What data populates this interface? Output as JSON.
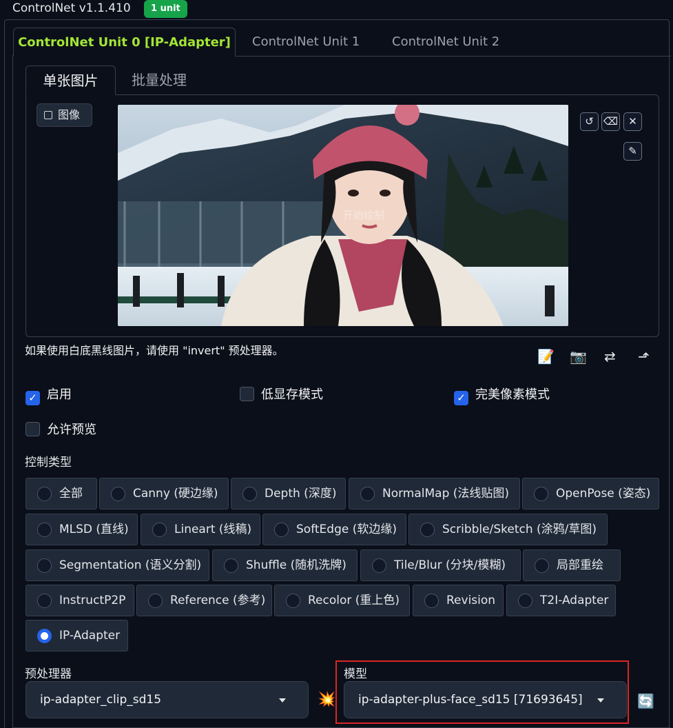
{
  "header": {
    "title": "ControlNet v1.1.410",
    "badge": "1 unit"
  },
  "unit_tabs": [
    {
      "label": "ControlNet Unit 0 [IP-Adapter]",
      "active": true
    },
    {
      "label": "ControlNet Unit 1",
      "active": false
    },
    {
      "label": "ControlNet Unit 2",
      "active": false
    }
  ],
  "input_tabs": [
    {
      "label": "单张图片",
      "active": true
    },
    {
      "label": "批量处理",
      "active": false
    }
  ],
  "image_panel": {
    "label": "图像",
    "watermark": "开始绘制",
    "tools": {
      "undo": "↺",
      "erase": "⌫",
      "close": "✕",
      "brush": "✎"
    }
  },
  "hint": "如果使用白底黑线图片，请使用 \"invert\" 预处理器。",
  "action_icons": {
    "edit": "📝",
    "camera": "📷",
    "swap": "⇄",
    "send": "⬏"
  },
  "checkboxes": [
    {
      "label": "启用",
      "checked": true
    },
    {
      "label": "低显存模式",
      "checked": false
    },
    {
      "label": "完美像素模式",
      "checked": true
    },
    {
      "label": "允许预览",
      "checked": false
    }
  ],
  "control_type": {
    "label": "控制类型",
    "options": [
      {
        "label": "全部",
        "selected": false
      },
      {
        "label": "Canny (硬边缘)",
        "selected": false
      },
      {
        "label": "Depth (深度)",
        "selected": false
      },
      {
        "label": "NormalMap (法线贴图)",
        "selected": false
      },
      {
        "label": "OpenPose (姿态)",
        "selected": false
      },
      {
        "label": "MLSD (直线)",
        "selected": false
      },
      {
        "label": "Lineart (线稿)",
        "selected": false
      },
      {
        "label": "SoftEdge (软边缘)",
        "selected": false
      },
      {
        "label": "Scribble/Sketch (涂鸦/草图)",
        "selected": false
      },
      {
        "label": "Segmentation (语义分割)",
        "selected": false
      },
      {
        "label": "Shuffle (随机洗牌)",
        "selected": false
      },
      {
        "label": "Tile/Blur (分块/模糊)",
        "selected": false
      },
      {
        "label": "局部重绘",
        "selected": false
      },
      {
        "label": "InstructP2P",
        "selected": false
      },
      {
        "label": "Reference (参考)",
        "selected": false
      },
      {
        "label": "Recolor (重上色)",
        "selected": false
      },
      {
        "label": "Revision",
        "selected": false
      },
      {
        "label": "T2I-Adapter",
        "selected": false
      },
      {
        "label": "IP-Adapter",
        "selected": true
      }
    ]
  },
  "preprocessor": {
    "label": "预处理器",
    "value": "ip-adapter_clip_sd15",
    "run_icon": "💥"
  },
  "model": {
    "label": "模型",
    "value": "ip-adapter-plus-face_sd15 [71693645]",
    "refresh_icon": "🔄"
  },
  "colors": {
    "accent": "#2563eb",
    "active_tab": "#a3e635",
    "badge": "#16a34a",
    "highlight_frame": "#dc2626"
  }
}
